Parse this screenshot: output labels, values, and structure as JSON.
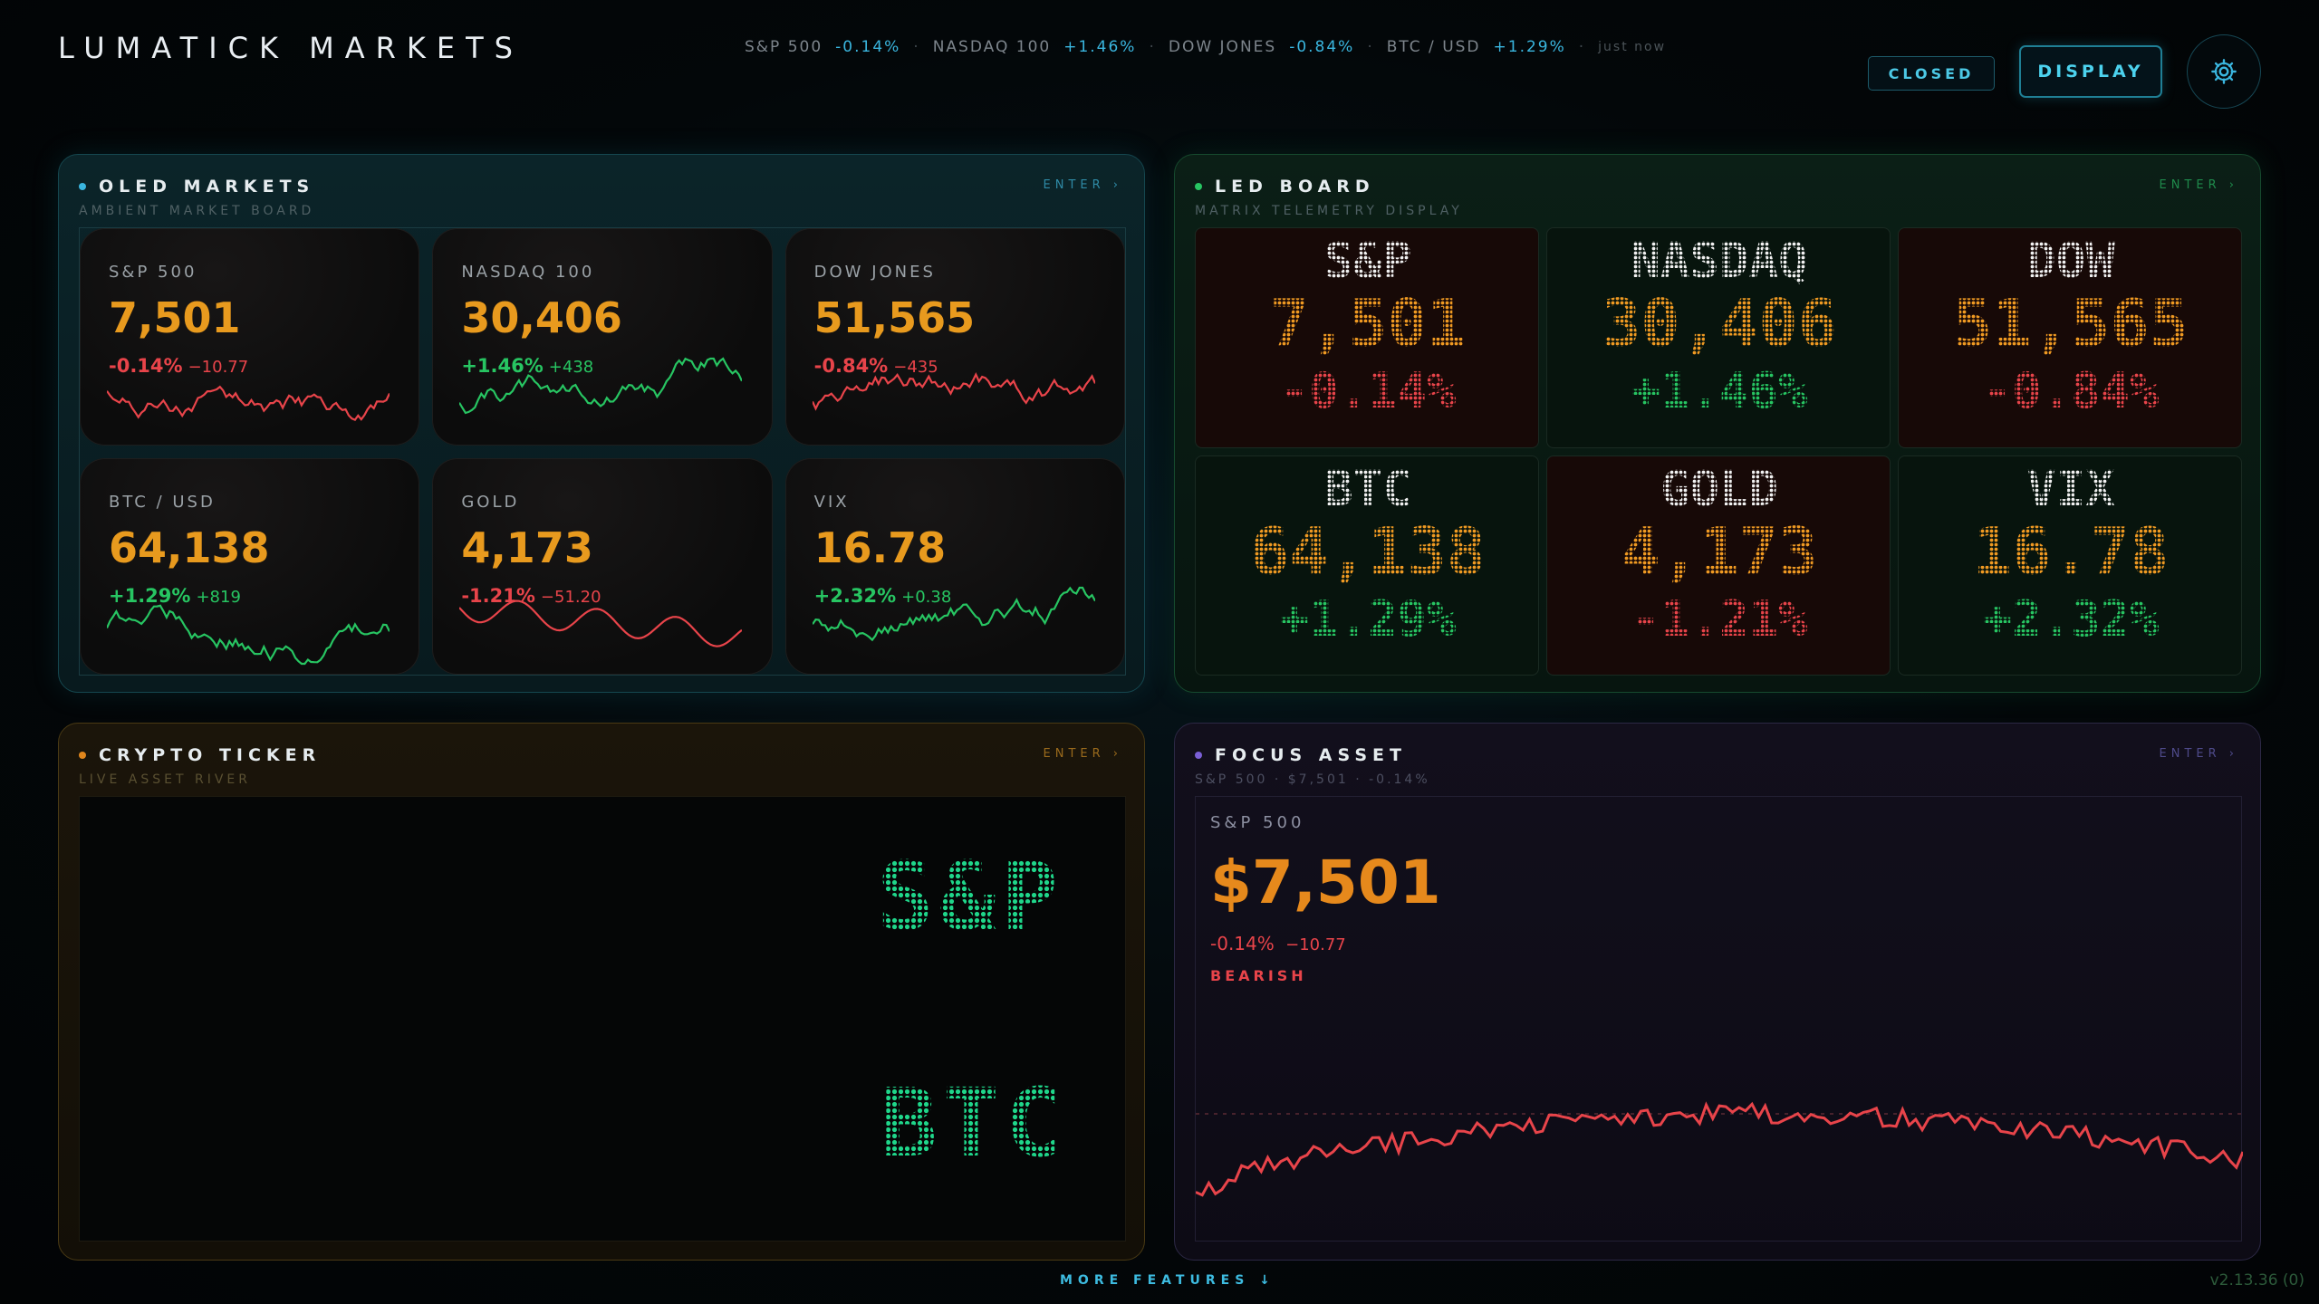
{
  "app": {
    "title": "LUMATICK MARKETS"
  },
  "ticker": {
    "items": [
      {
        "name": "S&P 500",
        "value": "-0.14%"
      },
      {
        "name": "NASDAQ 100",
        "value": "+1.46%"
      },
      {
        "name": "DOW JONES",
        "value": "-0.84%"
      },
      {
        "name": "BTC / USD",
        "value": "+1.29%"
      }
    ],
    "separator": "·",
    "updated": "just now"
  },
  "header": {
    "status": "CLOSED",
    "display_button": "DISPLAY",
    "settings_icon": "gear-icon"
  },
  "panels": {
    "oled": {
      "title": "OLED MARKETS",
      "subtitle": "AMBIENT MARKET BOARD",
      "enter": "ENTER ›",
      "accent": "#3ab6df",
      "cards": [
        {
          "name": "S&P 500",
          "price": "7,501",
          "change": "-0.14%",
          "delta": "−10.77",
          "dir": "neg"
        },
        {
          "name": "NASDAQ 100",
          "price": "30,406",
          "change": "+1.46%",
          "delta": "+438",
          "dir": "pos"
        },
        {
          "name": "DOW JONES",
          "price": "51,565",
          "change": "-0.84%",
          "delta": "−435",
          "dir": "neg"
        },
        {
          "name": "BTC / USD",
          "price": "64,138",
          "change": "+1.29%",
          "delta": "+819",
          "dir": "pos"
        },
        {
          "name": "GOLD",
          "price": "4,173",
          "change": "-1.21%",
          "delta": "−51.20",
          "dir": "neg"
        },
        {
          "name": "VIX",
          "price": "16.78",
          "change": "+2.32%",
          "delta": "+0.38",
          "dir": "pos"
        }
      ]
    },
    "led": {
      "title": "LED BOARD",
      "subtitle": "MATRIX TELEMETRY DISPLAY",
      "enter": "ENTER ›",
      "accent": "#27c562",
      "cells": [
        {
          "name": "S&P",
          "price": "7,501",
          "change": "-0.14%",
          "dir": "neg"
        },
        {
          "name": "NASDAQ",
          "price": "30,406",
          "change": "+1.46%",
          "dir": "pos"
        },
        {
          "name": "DOW",
          "price": "51,565",
          "change": "-0.84%",
          "dir": "neg"
        },
        {
          "name": "BTC",
          "price": "64,138",
          "change": "+1.29%",
          "dir": "pos"
        },
        {
          "name": "GOLD",
          "price": "4,173",
          "change": "-1.21%",
          "dir": "neg"
        },
        {
          "name": "VIX",
          "price": "16.78",
          "change": "+2.32%",
          "dir": "pos"
        }
      ]
    },
    "crypto": {
      "title": "CRYPTO TICKER",
      "subtitle": "LIVE ASSET RIVER",
      "enter": "ENTER ›",
      "accent": "#e0861c",
      "river": [
        "S&P",
        "BTC"
      ]
    },
    "focus": {
      "title": "FOCUS ASSET",
      "subtitle": "S&P 500 · $7,501 · -0.14%",
      "enter": "ENTER ›",
      "accent": "#7a5fd6",
      "asset": "S&P 500",
      "price": "$7,501",
      "change": "-0.14%",
      "delta": "−10.77",
      "trend": "BEARISH"
    }
  },
  "footer": {
    "more": "MORE FEATURES ↓",
    "version": "v2.13.36 (0)"
  }
}
